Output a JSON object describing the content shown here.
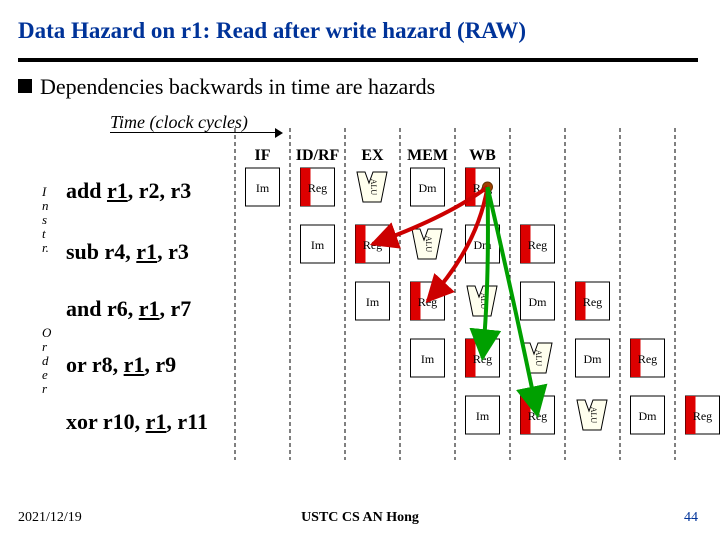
{
  "title": "Data Hazard on r1: Read after write hazard (RAW)",
  "bullet": "Dependencies backwards in time are hazards",
  "time_label": "Time (clock cycles)",
  "stages": {
    "if": "IF",
    "id": "ID/RF",
    "ex": "EX",
    "mem": "MEM",
    "wb": "WB"
  },
  "box": {
    "im": "Im",
    "reg": "Reg",
    "dm": "Dm",
    "alu": "ALU"
  },
  "side_label_1": "I\nn\ns\nt\nr.",
  "side_label_2": "O\nr\nd\ne\nr",
  "instructions": [
    {
      "text_pre": "add ",
      "r1": "r1",
      "text_post": ", r2, r3"
    },
    {
      "text_pre": "sub r4, ",
      "r1": "r1",
      "text_post": ", r3"
    },
    {
      "text_pre": "and r6, ",
      "r1": "r1",
      "text_post": ", r7"
    },
    {
      "text_pre": "or   r8, ",
      "r1": "r1",
      "text_post": ", r9"
    },
    {
      "text_pre": "xor r10, ",
      "r1": "r1",
      "text_post": ", r11"
    }
  ],
  "footer": {
    "left": "2021/12/19",
    "center": "USTC CS AN Hong",
    "right": "44"
  }
}
